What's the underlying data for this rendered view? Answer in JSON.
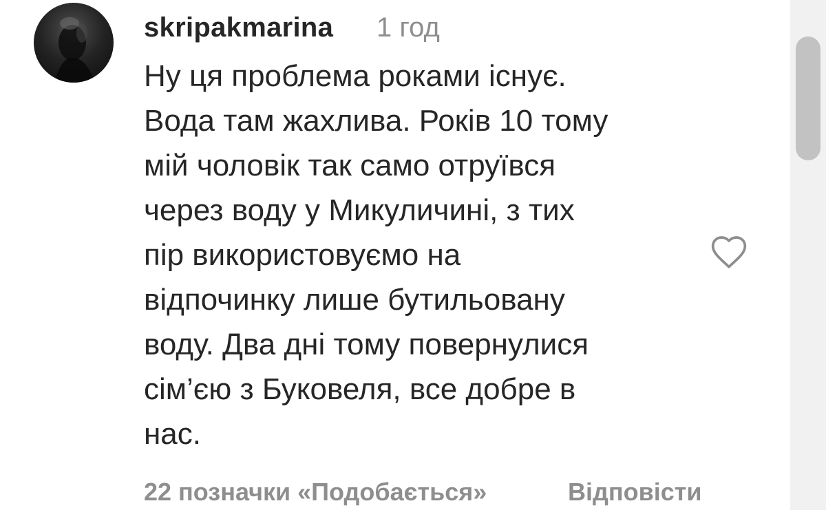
{
  "comment": {
    "username": "skripakmarina",
    "timestamp": "1 год",
    "text_lines": [
      "Ну ця проблема роками існує.",
      "Вода там жахлива. Років 10 тому",
      "мій чоловік так само отруївся",
      "через воду у Микуличині, з тих",
      "пір використовуємо на",
      "відпочинку лише бутильовану",
      "воду. Два дні тому повернулися",
      "сім’єю з Буковеля, все добре в",
      "нас."
    ],
    "likes_label": "22 позначки «Подобається»",
    "reply_label": "Відповісти"
  },
  "icons": {
    "avatar": "profile-photo",
    "like": "heart-outline-icon"
  },
  "colors": {
    "text": "#262626",
    "muted": "#8e8e8e",
    "scrollbar_thumb": "#c2c2c2",
    "scrollbar_track": "#f1f1f1"
  }
}
